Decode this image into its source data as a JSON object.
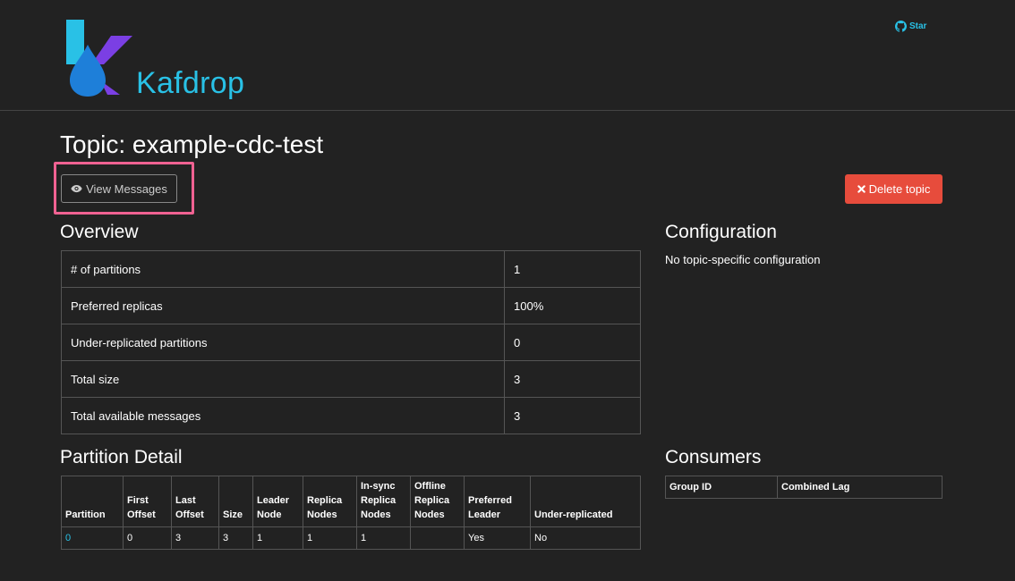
{
  "brand": "Kafdrop",
  "github": {
    "label": "Star"
  },
  "topic_title": "Topic: example-cdc-test",
  "buttons": {
    "view_messages": "View Messages",
    "delete_topic": "Delete topic"
  },
  "overview": {
    "title": "Overview",
    "rows": [
      {
        "key": "# of partitions",
        "value": "1"
      },
      {
        "key": "Preferred replicas",
        "value": "100%"
      },
      {
        "key": "Under-replicated partitions",
        "value": "0"
      },
      {
        "key": "Total size",
        "value": "3"
      },
      {
        "key": "Total available messages",
        "value": "3"
      }
    ]
  },
  "configuration": {
    "title": "Configuration",
    "text": "No topic-specific configuration"
  },
  "partition_detail": {
    "title": "Partition Detail",
    "headers": [
      [
        "Partition"
      ],
      [
        "First",
        "Offset"
      ],
      [
        "Last",
        "Offset"
      ],
      [
        "Size"
      ],
      [
        "Leader",
        "Node"
      ],
      [
        "Replica",
        "Nodes"
      ],
      [
        "In-sync",
        "Replica",
        "Nodes"
      ],
      [
        "Offline",
        "Replica",
        "Nodes"
      ],
      [
        "Preferred",
        "Leader"
      ],
      [
        "Under-replicated"
      ]
    ],
    "rows": [
      [
        "0",
        "0",
        "3",
        "3",
        "1",
        "1",
        "1",
        "",
        "Yes",
        "No"
      ]
    ]
  },
  "consumers": {
    "title": "Consumers",
    "headers": [
      "Group ID",
      "Combined Lag"
    ]
  },
  "colors": {
    "background": "#222222",
    "accent": "#29c1e6",
    "danger": "#e74c3c",
    "highlight": "#f06292"
  }
}
